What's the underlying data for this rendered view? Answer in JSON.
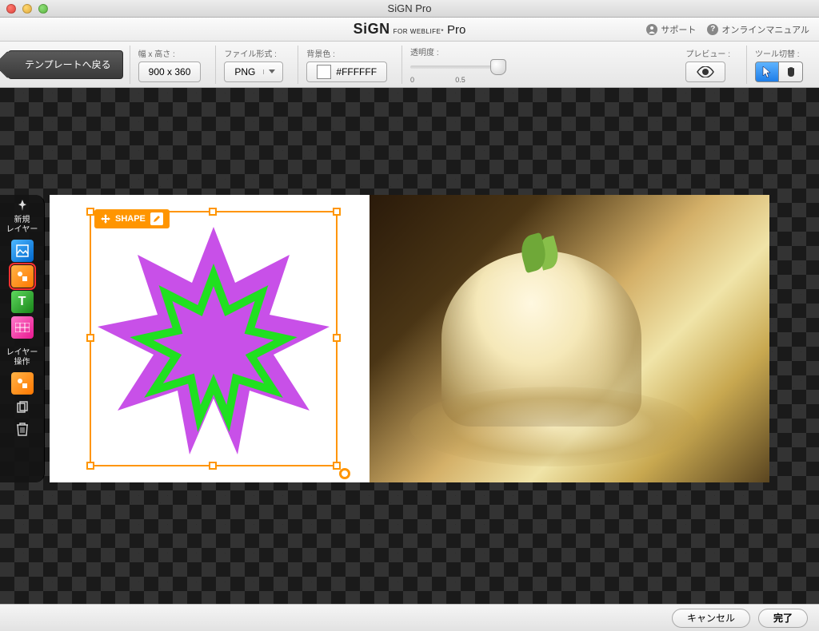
{
  "window": {
    "title": "SiGN Pro"
  },
  "brand": {
    "sign": "SiGN",
    "for": "FOR WEBLIFE*",
    "pro": "Pro",
    "support": "サポート",
    "manual": "オンラインマニュアル"
  },
  "toolbar": {
    "back": "テンプレートへ戻る",
    "size_label": "幅 x 高さ :",
    "size_value": "900 x 360",
    "format_label": "ファイル形式 :",
    "format_value": "PNG",
    "bgcolor_label": "背景色 :",
    "bgcolor_value": "#FFFFFF",
    "opacity_label": "透明度 :",
    "opacity_min": "0",
    "opacity_mid": "0.5",
    "preview_label": "プレビュー :",
    "tool_label": "ツール切替 :"
  },
  "sidebar": {
    "new_layer": "新規\nレイヤー",
    "layer_ops": "レイヤー\n操作",
    "text_t": "T"
  },
  "shape_tag": {
    "label": "SHAPE"
  },
  "footer": {
    "cancel": "キャンセル",
    "done": "完了"
  }
}
